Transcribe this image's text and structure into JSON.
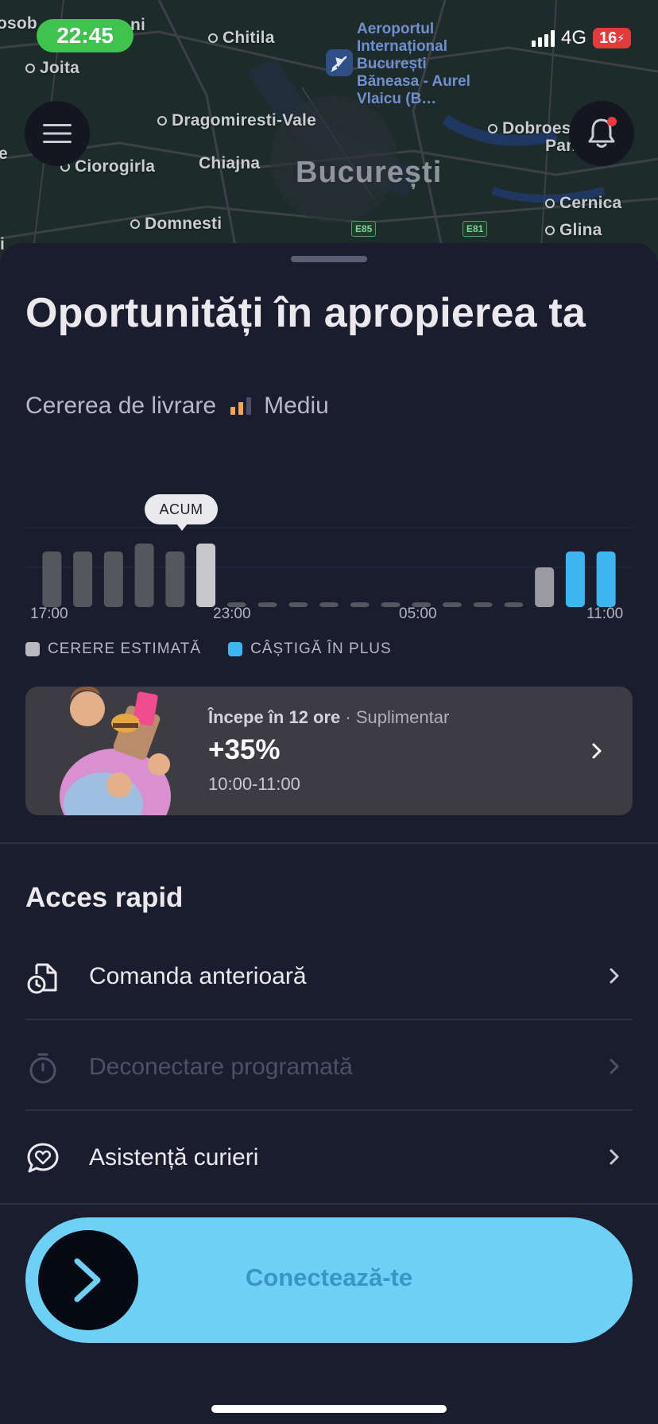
{
  "status_bar": {
    "time": "22:45",
    "network": "4G",
    "battery": "16"
  },
  "map": {
    "labels": [
      "osob",
      "Chitila",
      "Joita",
      "Dragomiresti-Vale",
      "Ciorogirla",
      "Chiajna",
      "Domnesti",
      "Dobroes",
      "Pante",
      "Cernica",
      "Glina",
      "ni",
      "e",
      "i"
    ],
    "city": "București",
    "airport": "Aeroportul Internațional București Băneasa - Aurel Vlaicu (B…",
    "road_badges": [
      "E85",
      "E81"
    ]
  },
  "sheet": {
    "title": "Oportunități în apropierea ta",
    "demand_label": "Cererea de livrare",
    "demand_level": "Mediu",
    "now_tag": "ACUM",
    "legend": {
      "estimated": "CERERE ESTIMATĂ",
      "bonus": "CÂȘTIGĂ ÎN PLUS"
    },
    "promo": {
      "starts": "Începe în 12 ore",
      "separator": "·",
      "kind": "Suplimentar",
      "percent": "+35%",
      "hours": "10:00-11:00"
    },
    "quick_access": {
      "title": "Acces rapid",
      "items": [
        {
          "label": "Comanda anterioară",
          "icon": "document-clock-icon",
          "enabled": true
        },
        {
          "label": "Deconectare programată",
          "icon": "stopwatch-icon",
          "enabled": false
        },
        {
          "label": "Asistență curieri",
          "icon": "heart-chat-icon",
          "enabled": true
        }
      ]
    },
    "connect_label": "Conectează-te"
  },
  "chart_data": {
    "type": "bar",
    "categories": [
      "17:00",
      "18:00",
      "19:00",
      "20:00",
      "21:00",
      "22:00",
      "23:00",
      "00:00",
      "01:00",
      "02:00",
      "03:00",
      "04:00",
      "05:00",
      "06:00",
      "07:00",
      "08:00",
      "09:00",
      "10:00",
      "11:00"
    ],
    "x_ticks": [
      "17:00",
      "23:00",
      "05:00",
      "11:00"
    ],
    "series": [
      {
        "name": "CERERE ESTIMATĂ",
        "values": [
          0.7,
          0.7,
          0.7,
          0.8,
          0.7,
          0.8,
          0.05,
          0.05,
          0.05,
          0.05,
          0.05,
          0.05,
          0.05,
          0.05,
          0.05,
          0.05,
          0.5,
          0,
          0
        ]
      },
      {
        "name": "CÂȘTIGĂ ÎN PLUS",
        "values": [
          0,
          0,
          0,
          0,
          0,
          0,
          0,
          0,
          0,
          0,
          0,
          0,
          0,
          0,
          0,
          0,
          0,
          0.7,
          0.7
        ]
      }
    ],
    "current_index": 5,
    "colors": {
      "past": "#55575f",
      "now": "#c8c8cc",
      "future": "#9a9aa0",
      "bonus": "#3eb5ef"
    },
    "ylim": [
      0,
      1
    ]
  }
}
